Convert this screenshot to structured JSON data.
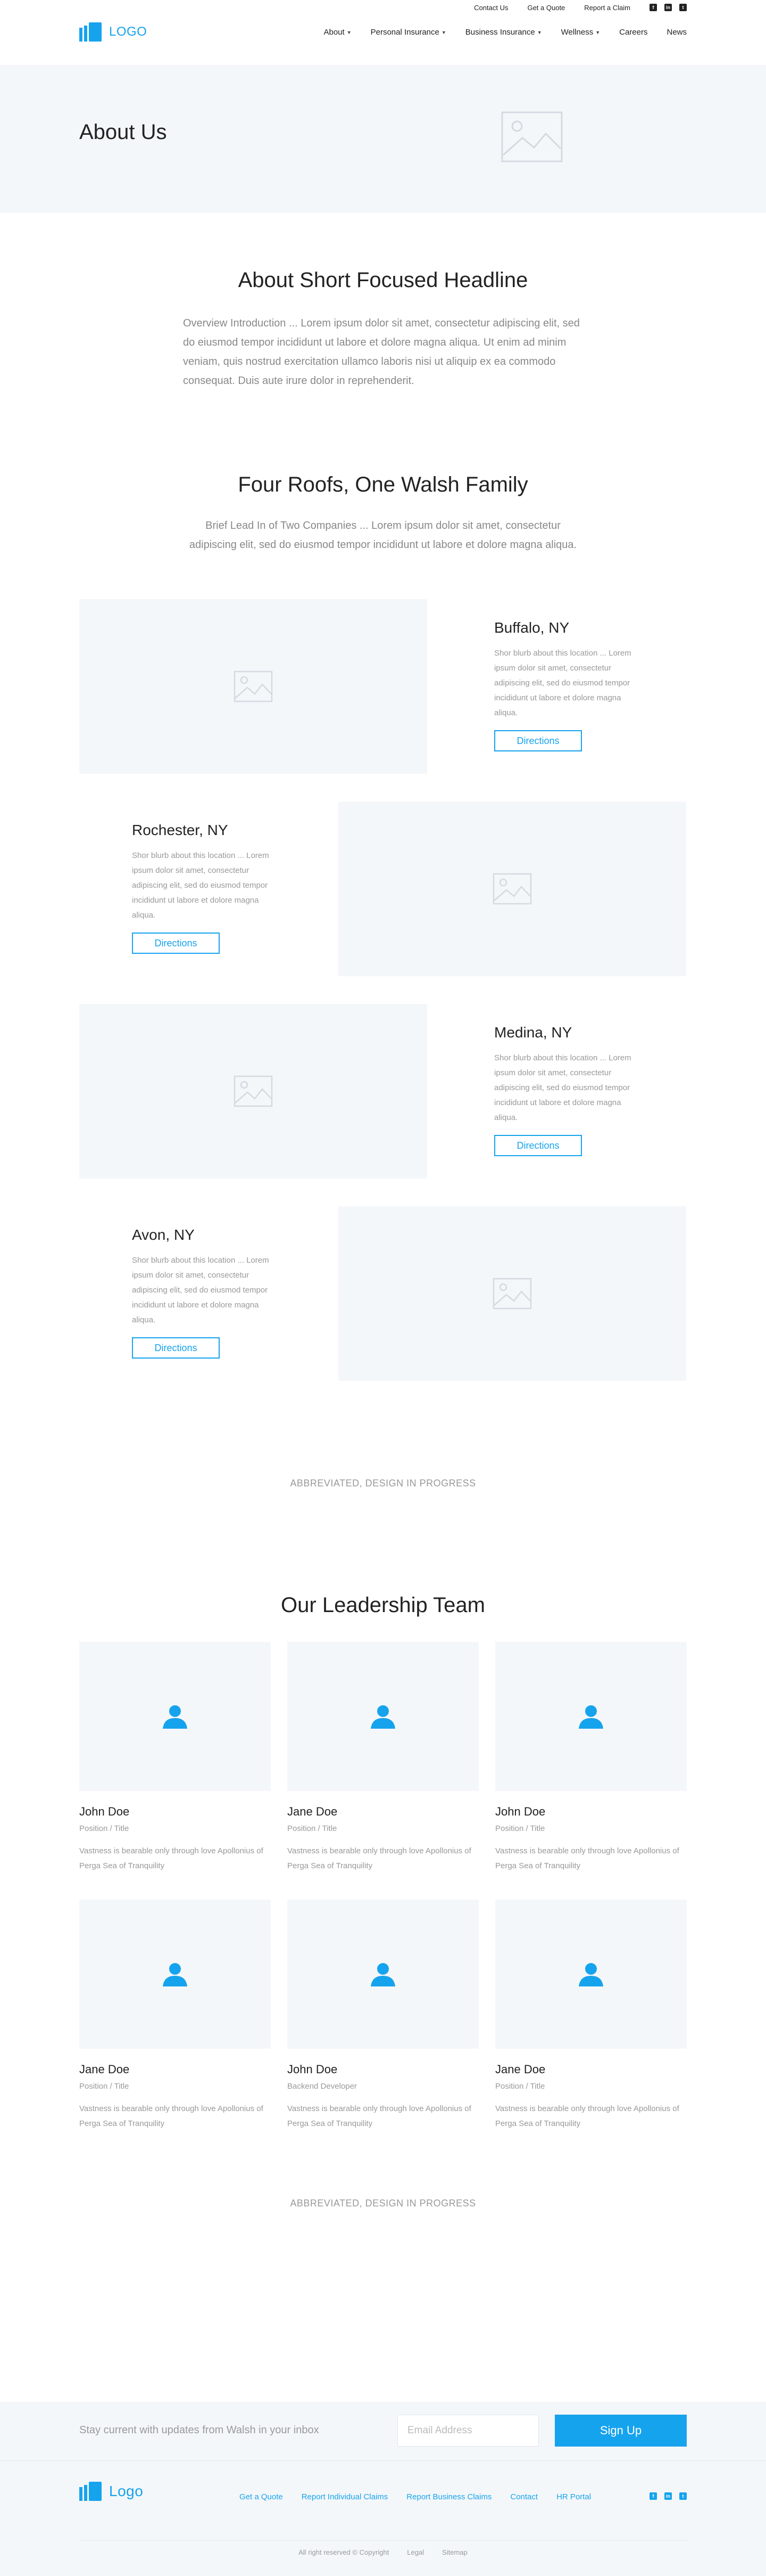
{
  "topbar": {
    "links": [
      "Contact Us",
      "Get a Quote",
      "Report a Claim"
    ],
    "social": [
      "facebook-icon",
      "linkedin-icon",
      "twitter-icon"
    ]
  },
  "header": {
    "logo": "LOGO",
    "nav": [
      {
        "label": "About",
        "dropdown": true
      },
      {
        "label": "Personal Insurance",
        "dropdown": true
      },
      {
        "label": "Business Insurance",
        "dropdown": true
      },
      {
        "label": "Wellness",
        "dropdown": true
      },
      {
        "label": "Careers",
        "dropdown": false
      },
      {
        "label": "News",
        "dropdown": false
      }
    ]
  },
  "hero": {
    "title": "About Us"
  },
  "about": {
    "headline": "About Short Focused Headline",
    "body": "Overview Introduction ... Lorem ipsum dolor sit amet, consectetur adipiscing elit, sed do eiusmod tempor incididunt ut labore et dolore magna aliqua. Ut enim ad minim veniam, quis nostrud exercitation ullamco laboris nisi ut aliquip ex ea commodo consequat. Duis aute irure dolor in reprehenderit."
  },
  "family": {
    "headline": "Four Roofs, One Walsh Family",
    "lead": "Brief Lead In of Two Companies ... Lorem ipsum dolor sit amet, consectetur adipiscing elit, sed do eiusmod tempor incididunt ut labore et dolore magna aliqua.",
    "locations": [
      {
        "name": "Buffalo, NY",
        "blurb": "Shor blurb about this location ... Lorem ipsum dolor sit amet, consectetur adipiscing elit, sed do eiusmod tempor incididunt ut labore et dolore magna aliqua.",
        "button": "Directions"
      },
      {
        "name": "Rochester, NY",
        "blurb": "Shor blurb about this location ... Lorem ipsum dolor sit amet, consectetur adipiscing elit, sed do eiusmod tempor incididunt ut labore et dolore magna aliqua.",
        "button": "Directions"
      },
      {
        "name": "Medina, NY",
        "blurb": "Shor blurb about this location ... Lorem ipsum dolor sit amet, consectetur adipiscing elit, sed do eiusmod tempor incididunt ut labore et dolore magna aliqua.",
        "button": "Directions"
      },
      {
        "name": "Avon, NY",
        "blurb": "Shor blurb about this location ... Lorem ipsum dolor sit amet, consectetur adipiscing elit, sed do eiusmod tempor incididunt ut labore et dolore magna aliqua.",
        "button": "Directions"
      }
    ]
  },
  "abbrev1": "ABBREVIATED, DESIGN IN PROGRESS",
  "team": {
    "headline": "Our Leadership Team",
    "members": [
      {
        "name": "John Doe",
        "position": "Position / Title",
        "bio": "Vastness is bearable only through love Apollonius of Perga Sea of Tranquility"
      },
      {
        "name": "Jane Doe",
        "position": "Position / Title",
        "bio": "Vastness is bearable only through love Apollonius of Perga Sea of Tranquility"
      },
      {
        "name": "John Doe",
        "position": "Position / Title",
        "bio": "Vastness is bearable only through love Apollonius of Perga Sea of Tranquility"
      },
      {
        "name": "Jane Doe",
        "position": "Position / Title",
        "bio": "Vastness is bearable only through love Apollonius of Perga Sea of Tranquility"
      },
      {
        "name": "John Doe",
        "position": "Backend Developer",
        "bio": "Vastness is bearable only through love Apollonius of Perga Sea of Tranquility"
      },
      {
        "name": "Jane Doe",
        "position": "Position / Title",
        "bio": "Vastness is bearable only through love Apollonius of Perga Sea of Tranquility"
      }
    ]
  },
  "abbrev2": "ABBREVIATED, DESIGN IN PROGRESS",
  "newsletter": {
    "text": "Stay current with updates from Walsh in your inbox",
    "placeholder": "Email Address",
    "button": "Sign Up"
  },
  "footer": {
    "logo": "Logo",
    "links": [
      "Get a Quote",
      "Report Individual Claims",
      "Report Business Claims",
      "Contact",
      "HR Portal"
    ],
    "social": [
      "facebook-icon",
      "linkedin-icon",
      "twitter-icon"
    ],
    "copyright": "All right reserved © Copyright",
    "legal": "Legal",
    "sitemap": "Sitemap"
  },
  "colors": {
    "accent": "#16a3ee",
    "placeholder_bg": "#f4f7fa"
  }
}
